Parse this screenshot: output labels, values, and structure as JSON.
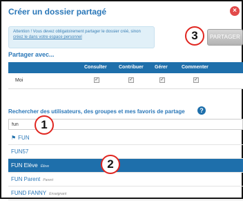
{
  "dialog": {
    "title": "Créer un dossier partagé",
    "close_label": "×"
  },
  "warning": {
    "line1": "Attention ! Vous devez obligatoirement partager le dossier créé, sinon",
    "line2": "créez le dans votre espace personnel"
  },
  "share_button": {
    "label": "PARTAGER"
  },
  "badges": {
    "one": "1",
    "two": "2",
    "three": "3"
  },
  "share_with": {
    "label": "Partager avec...",
    "columns": [
      "Consulter",
      "Contribuer",
      "Gérer",
      "Commenter"
    ],
    "rows": [
      {
        "name": "Moi",
        "checks": [
          true,
          true,
          true,
          true
        ]
      }
    ]
  },
  "search": {
    "label": "Rechercher des utilisateurs, des groupes et mes favoris de partage",
    "value": "fun"
  },
  "results": [
    {
      "name": "FUN",
      "sub": "",
      "flag": true,
      "selected": false
    },
    {
      "name": "FUN57",
      "sub": "",
      "flag": false,
      "selected": false
    },
    {
      "name": "FUN Elève",
      "sub": "Élève",
      "flag": false,
      "selected": true
    },
    {
      "name": "FUN Parent",
      "sub": "Parent",
      "flag": false,
      "selected": false
    },
    {
      "name": "FUND FANNY",
      "sub": "Enseignant",
      "flag": false,
      "selected": false
    }
  ],
  "colors": {
    "accent": "#2a77b8",
    "header_blue": "#1e6fab",
    "badge_red": "#e0251f"
  }
}
